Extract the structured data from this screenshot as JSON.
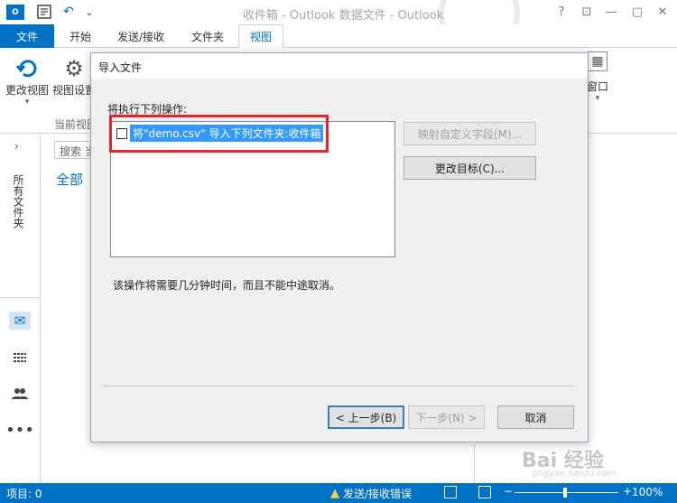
{
  "window": {
    "title": "收件箱 - Outlook 数据文件 - Outlook",
    "logo_text": "O",
    "buttons": [
      "?",
      "⊡",
      "—",
      "▢",
      "✕"
    ]
  },
  "quick_access": {
    "icons": [
      "send-receive-icon",
      "undo-icon",
      "customize-icon"
    ],
    "undo": "↶",
    "dropdown": "⌄"
  },
  "ribbon": {
    "tabs": [
      {
        "label": "文件"
      },
      {
        "label": "开始"
      },
      {
        "label": "发送/接收"
      },
      {
        "label": "文件夹"
      },
      {
        "label": "视图"
      }
    ],
    "change_view_label": "更改视图",
    "view_settings_label": "视图设置",
    "window_label": "窗口",
    "current_view_group": "当前视图"
  },
  "nav": {
    "expand": "›",
    "all_folders_label": "所有文件夹"
  },
  "list_pane": {
    "search_placeholder": "搜索 当",
    "filter_all": "全部"
  },
  "status": {
    "items_label": "项目: 0",
    "warning_label": "发送/接收错误",
    "zoom_minus": "−",
    "zoom_plus": "+",
    "zoom_level": "100%"
  },
  "dialog": {
    "title": "导入文件",
    "prompt": "将执行下列操作:",
    "action_item": "将\"demo.csv\" 导入下列文件夹:收件箱",
    "map_fields_button": "映射自定义字段(M)...",
    "change_destination_button": "更改目标(C)...",
    "note": "该操作将需要几分钟时间，而且不能中途取消。",
    "back_button": "< 上一步(B)",
    "next_button": "下一步(N) >",
    "cancel_button": "取消"
  },
  "watermark": {
    "text": "Bai 经验",
    "sub": "jingyan.baidu.com"
  },
  "colors": {
    "accent": "#0072c6",
    "selection": "#3399ff",
    "highlight_border": "#e0272d"
  }
}
